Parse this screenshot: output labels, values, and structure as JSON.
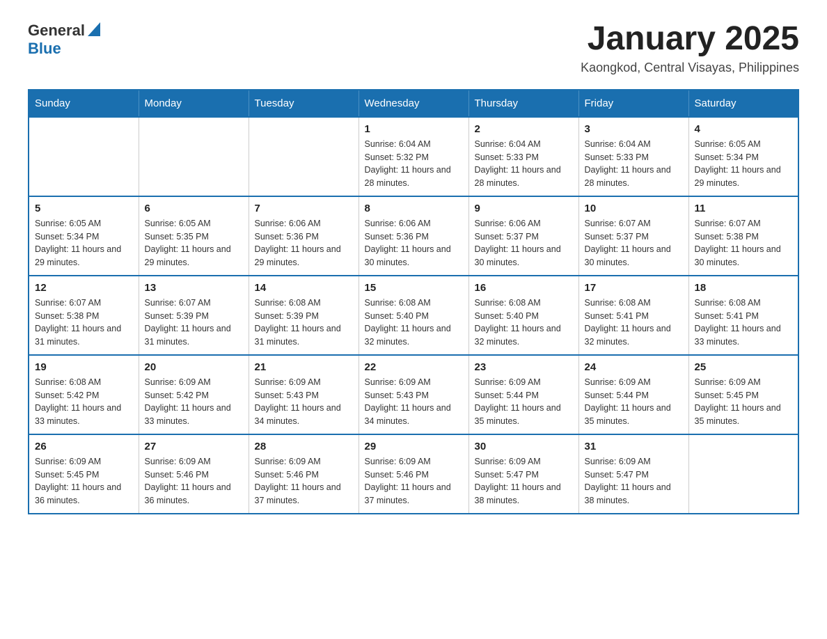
{
  "header": {
    "logo": {
      "general": "General",
      "blue": "Blue"
    },
    "title": "January 2025",
    "subtitle": "Kaongkod, Central Visayas, Philippines"
  },
  "weekdays": [
    "Sunday",
    "Monday",
    "Tuesday",
    "Wednesday",
    "Thursday",
    "Friday",
    "Saturday"
  ],
  "weeks": [
    [
      {
        "day": "",
        "info": ""
      },
      {
        "day": "",
        "info": ""
      },
      {
        "day": "",
        "info": ""
      },
      {
        "day": "1",
        "info": "Sunrise: 6:04 AM\nSunset: 5:32 PM\nDaylight: 11 hours and 28 minutes."
      },
      {
        "day": "2",
        "info": "Sunrise: 6:04 AM\nSunset: 5:33 PM\nDaylight: 11 hours and 28 minutes."
      },
      {
        "day": "3",
        "info": "Sunrise: 6:04 AM\nSunset: 5:33 PM\nDaylight: 11 hours and 28 minutes."
      },
      {
        "day": "4",
        "info": "Sunrise: 6:05 AM\nSunset: 5:34 PM\nDaylight: 11 hours and 29 minutes."
      }
    ],
    [
      {
        "day": "5",
        "info": "Sunrise: 6:05 AM\nSunset: 5:34 PM\nDaylight: 11 hours and 29 minutes."
      },
      {
        "day": "6",
        "info": "Sunrise: 6:05 AM\nSunset: 5:35 PM\nDaylight: 11 hours and 29 minutes."
      },
      {
        "day": "7",
        "info": "Sunrise: 6:06 AM\nSunset: 5:36 PM\nDaylight: 11 hours and 29 minutes."
      },
      {
        "day": "8",
        "info": "Sunrise: 6:06 AM\nSunset: 5:36 PM\nDaylight: 11 hours and 30 minutes."
      },
      {
        "day": "9",
        "info": "Sunrise: 6:06 AM\nSunset: 5:37 PM\nDaylight: 11 hours and 30 minutes."
      },
      {
        "day": "10",
        "info": "Sunrise: 6:07 AM\nSunset: 5:37 PM\nDaylight: 11 hours and 30 minutes."
      },
      {
        "day": "11",
        "info": "Sunrise: 6:07 AM\nSunset: 5:38 PM\nDaylight: 11 hours and 30 minutes."
      }
    ],
    [
      {
        "day": "12",
        "info": "Sunrise: 6:07 AM\nSunset: 5:38 PM\nDaylight: 11 hours and 31 minutes."
      },
      {
        "day": "13",
        "info": "Sunrise: 6:07 AM\nSunset: 5:39 PM\nDaylight: 11 hours and 31 minutes."
      },
      {
        "day": "14",
        "info": "Sunrise: 6:08 AM\nSunset: 5:39 PM\nDaylight: 11 hours and 31 minutes."
      },
      {
        "day": "15",
        "info": "Sunrise: 6:08 AM\nSunset: 5:40 PM\nDaylight: 11 hours and 32 minutes."
      },
      {
        "day": "16",
        "info": "Sunrise: 6:08 AM\nSunset: 5:40 PM\nDaylight: 11 hours and 32 minutes."
      },
      {
        "day": "17",
        "info": "Sunrise: 6:08 AM\nSunset: 5:41 PM\nDaylight: 11 hours and 32 minutes."
      },
      {
        "day": "18",
        "info": "Sunrise: 6:08 AM\nSunset: 5:41 PM\nDaylight: 11 hours and 33 minutes."
      }
    ],
    [
      {
        "day": "19",
        "info": "Sunrise: 6:08 AM\nSunset: 5:42 PM\nDaylight: 11 hours and 33 minutes."
      },
      {
        "day": "20",
        "info": "Sunrise: 6:09 AM\nSunset: 5:42 PM\nDaylight: 11 hours and 33 minutes."
      },
      {
        "day": "21",
        "info": "Sunrise: 6:09 AM\nSunset: 5:43 PM\nDaylight: 11 hours and 34 minutes."
      },
      {
        "day": "22",
        "info": "Sunrise: 6:09 AM\nSunset: 5:43 PM\nDaylight: 11 hours and 34 minutes."
      },
      {
        "day": "23",
        "info": "Sunrise: 6:09 AM\nSunset: 5:44 PM\nDaylight: 11 hours and 35 minutes."
      },
      {
        "day": "24",
        "info": "Sunrise: 6:09 AM\nSunset: 5:44 PM\nDaylight: 11 hours and 35 minutes."
      },
      {
        "day": "25",
        "info": "Sunrise: 6:09 AM\nSunset: 5:45 PM\nDaylight: 11 hours and 35 minutes."
      }
    ],
    [
      {
        "day": "26",
        "info": "Sunrise: 6:09 AM\nSunset: 5:45 PM\nDaylight: 11 hours and 36 minutes."
      },
      {
        "day": "27",
        "info": "Sunrise: 6:09 AM\nSunset: 5:46 PM\nDaylight: 11 hours and 36 minutes."
      },
      {
        "day": "28",
        "info": "Sunrise: 6:09 AM\nSunset: 5:46 PM\nDaylight: 11 hours and 37 minutes."
      },
      {
        "day": "29",
        "info": "Sunrise: 6:09 AM\nSunset: 5:46 PM\nDaylight: 11 hours and 37 minutes."
      },
      {
        "day": "30",
        "info": "Sunrise: 6:09 AM\nSunset: 5:47 PM\nDaylight: 11 hours and 38 minutes."
      },
      {
        "day": "31",
        "info": "Sunrise: 6:09 AM\nSunset: 5:47 PM\nDaylight: 11 hours and 38 minutes."
      },
      {
        "day": "",
        "info": ""
      }
    ]
  ]
}
